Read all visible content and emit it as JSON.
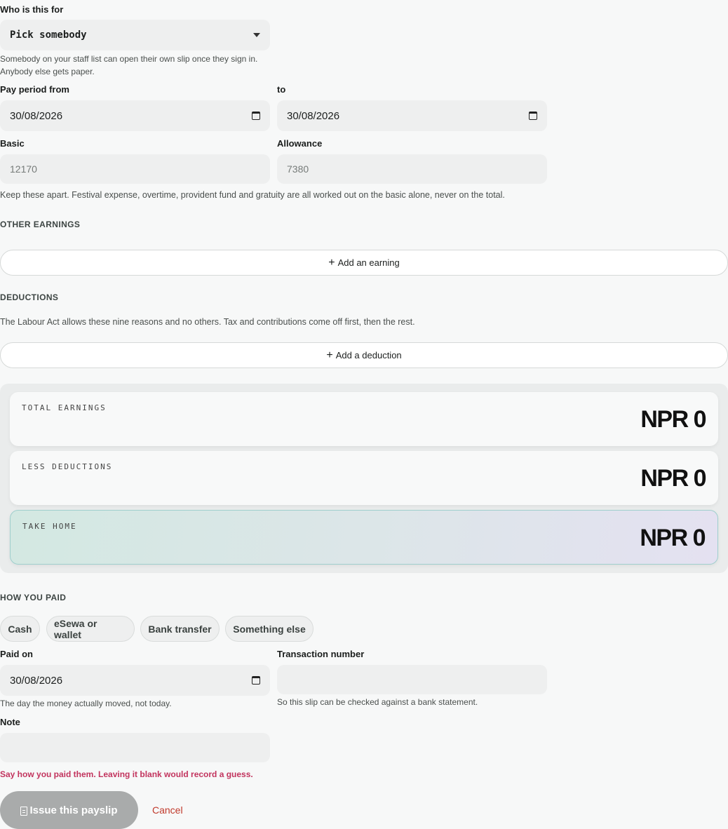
{
  "recipient": {
    "label": "Who is this for",
    "selected": "Pick somebody",
    "help_line1": "Somebody on your staff list can open their own slip once they sign in.",
    "help_line2": "Anybody else gets paper."
  },
  "pay_period": {
    "from_label": "Pay period from",
    "from_value": "30/08/2026",
    "to_label": "to",
    "to_value": "30/08/2026"
  },
  "pay": {
    "basic_label": "Basic",
    "basic_placeholder": "12170",
    "allowance_label": "Allowance",
    "allowance_placeholder": "7380",
    "help": "Keep these apart. Festival expense, overtime, provident fund and gratuity are all worked out on the basic alone, never on the total."
  },
  "other_earnings": {
    "title": "OTHER EARNINGS",
    "add_label": "Add an earning"
  },
  "deductions": {
    "title": "DEDUCTIONS",
    "help": "The Labour Act allows these nine reasons and no others. Tax and contributions come off first, then the rest.",
    "add_label": "Add a deduction"
  },
  "summary": {
    "total_earnings_label": "TOTAL EARNINGS",
    "total_earnings_value": "NPR 0",
    "less_deductions_label": "LESS DEDUCTIONS",
    "less_deductions_value": "NPR 0",
    "take_home_label": "TAKE HOME",
    "take_home_value": "NPR 0"
  },
  "payment": {
    "title": "HOW YOU PAID",
    "methods": [
      "Cash",
      "eSewa or wallet",
      "Bank transfer",
      "Something else"
    ],
    "paid_on_label": "Paid on",
    "paid_on_value": "30/08/2026",
    "paid_on_help": "The day the money actually moved, not today.",
    "txn_label": "Transaction number",
    "txn_help": "So this slip can be checked against a bank statement.",
    "note_label": "Note",
    "error": "Say how you paid them. Leaving it blank would record a guess."
  },
  "actions": {
    "issue_label": "Issue this payslip",
    "cancel_label": "Cancel"
  },
  "colors": {
    "error": "#c2345e",
    "cancel": "#c0392b",
    "take_home_border": "#9fcfcd"
  }
}
